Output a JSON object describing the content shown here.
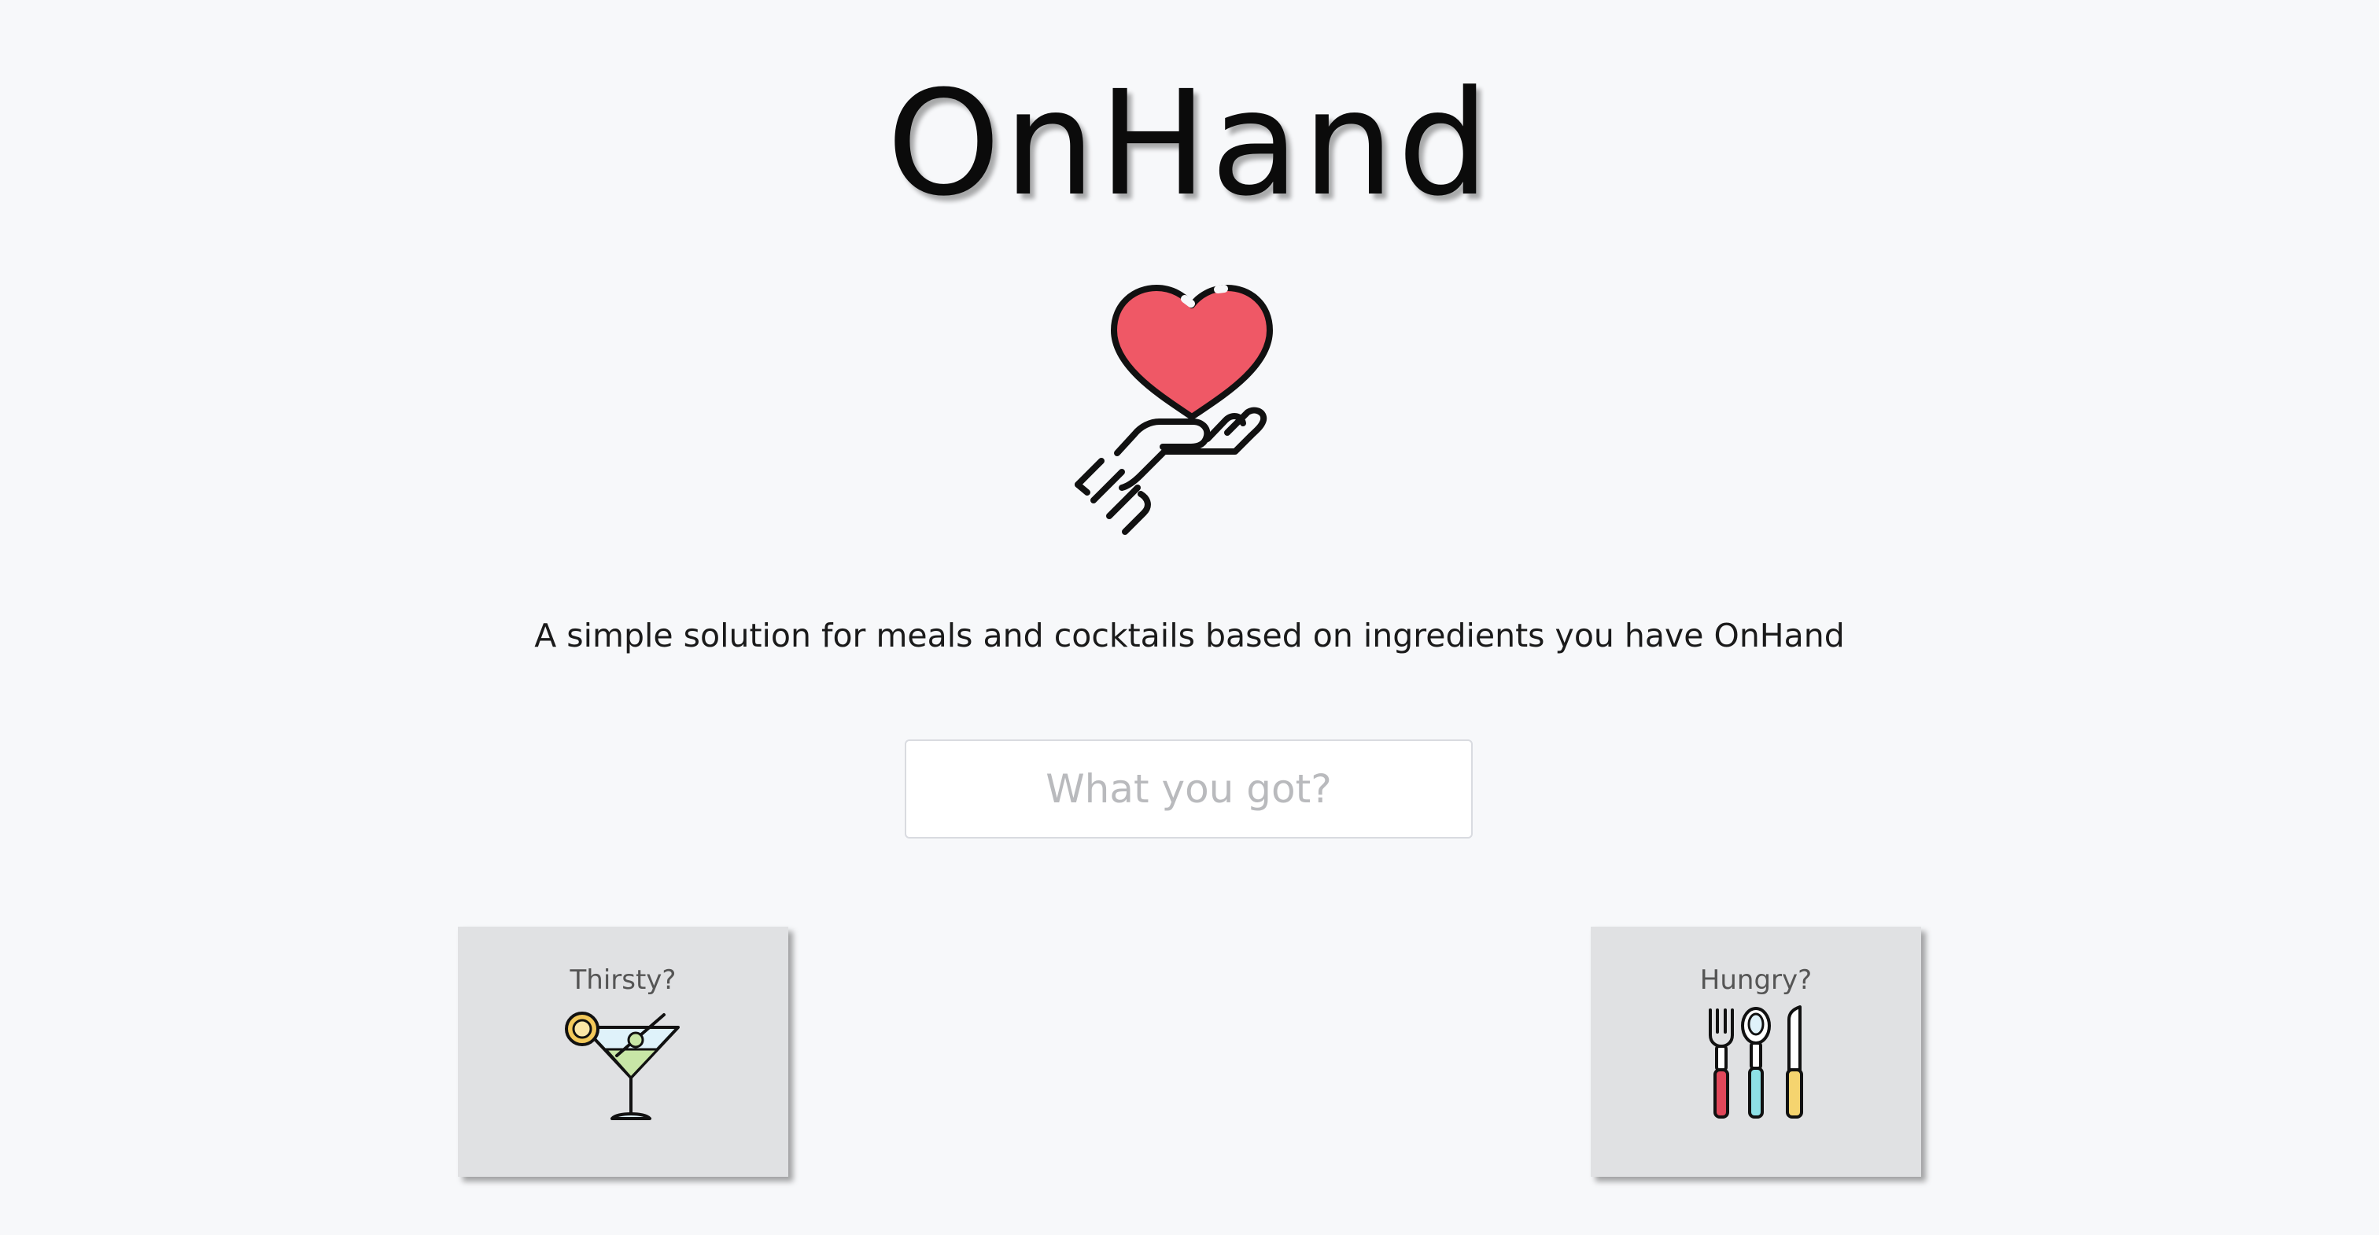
{
  "app": {
    "title": "OnHand",
    "tagline": "A simple solution for meals and cocktails based on ingredients you have OnHand"
  },
  "hero": {
    "icon": "heart-in-hand-icon",
    "colors": {
      "heart": "#ef5866",
      "outline": "#111111"
    }
  },
  "search": {
    "value": "",
    "placeholder": "What you got?"
  },
  "cards": [
    {
      "label": "Thirsty?",
      "icon": "cocktail-glass-icon"
    },
    {
      "label": "Hungry?",
      "icon": "cutlery-icon"
    }
  ],
  "colors": {
    "background": "#f7f8fa",
    "card": "#e0e1e3",
    "fork_handle": "#e0475a",
    "spoon_handle": "#8ee0e6",
    "knife_handle": "#f5d46f",
    "cocktail_liquid": "#c8e6a6",
    "cocktail_glass": "#dff2fa",
    "lemon": "#f3c95a"
  }
}
